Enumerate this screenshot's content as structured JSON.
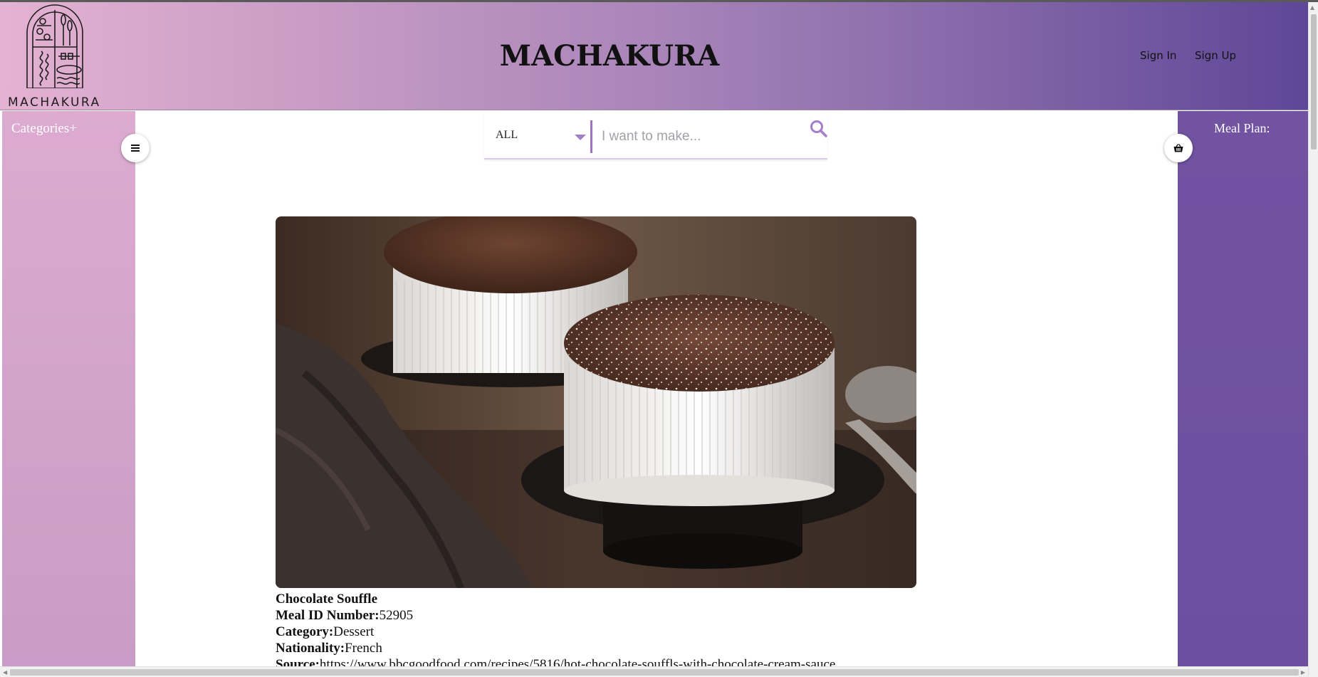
{
  "header": {
    "logo_text": "MACHAKURA",
    "title": "MACHAKURA",
    "sign_in": "Sign In",
    "sign_up": "Sign Up"
  },
  "sidebar_left": {
    "label": "Categories+"
  },
  "sidebar_right": {
    "label": "Meal Plan:"
  },
  "search": {
    "category_selected": "ALL",
    "placeholder": "I want to make..."
  },
  "meal": {
    "name": "Chocolate Souffle",
    "id_label": "Meal ID Number:",
    "id_value": "52905",
    "category_label": "Category:",
    "category_value": "Dessert",
    "nationality_label": "Nationality:",
    "nationality_value": "French",
    "source_label": "Source:",
    "source_value": "https://www.bbcgoodfood.com/recipes/5816/hot-chocolate-souffls-with-chocolate-cream-sauce"
  },
  "icons": {
    "menu": "hamburger-menu-icon",
    "basket": "basket-icon",
    "search": "magnifier-icon",
    "dropdown": "caret-down-icon"
  },
  "colors": {
    "header_gradient_start": "#e4b2d2",
    "header_gradient_end": "#5e4797",
    "left_sidebar": "#d3a5cc",
    "right_sidebar": "#7253a2",
    "accent": "#9c73be"
  }
}
